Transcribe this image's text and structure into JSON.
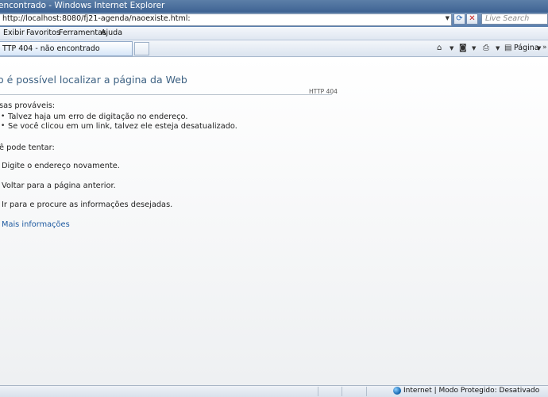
{
  "window": {
    "title": "encontrado - Windows Internet Explorer"
  },
  "address": {
    "url": "http://localhost:8080/fj21-agenda/naoexiste.html:"
  },
  "search": {
    "placeholder": "Live Search"
  },
  "menu": [
    "Exibir",
    "Favoritos",
    "Ferramentas",
    "Ajuda"
  ],
  "tab": {
    "label": "TTP 404 - não encontrado"
  },
  "commandbar": {
    "page_label": "Página"
  },
  "page": {
    "title": "o é possível localizar a página da Web",
    "code": "HTTP 404",
    "causes_heading": "sas prováveis:",
    "causes": [
      "Talvez haja um erro de digitação no endereço.",
      "Se você clicou em um link, talvez ele esteja desatualizado."
    ],
    "try_heading": "ê pode tentar:",
    "actions": [
      "Digite o endereço novamente.",
      "Voltar para a página anterior.",
      "Ir para  e procure as informações desejadas."
    ],
    "more_info": "Mais informações"
  },
  "status": {
    "zone": "Internet | Modo Protegido: Desativado"
  },
  "colors": {
    "titlebar": "#3d6292",
    "heading": "#3e6283",
    "link": "#1e5aa0"
  }
}
